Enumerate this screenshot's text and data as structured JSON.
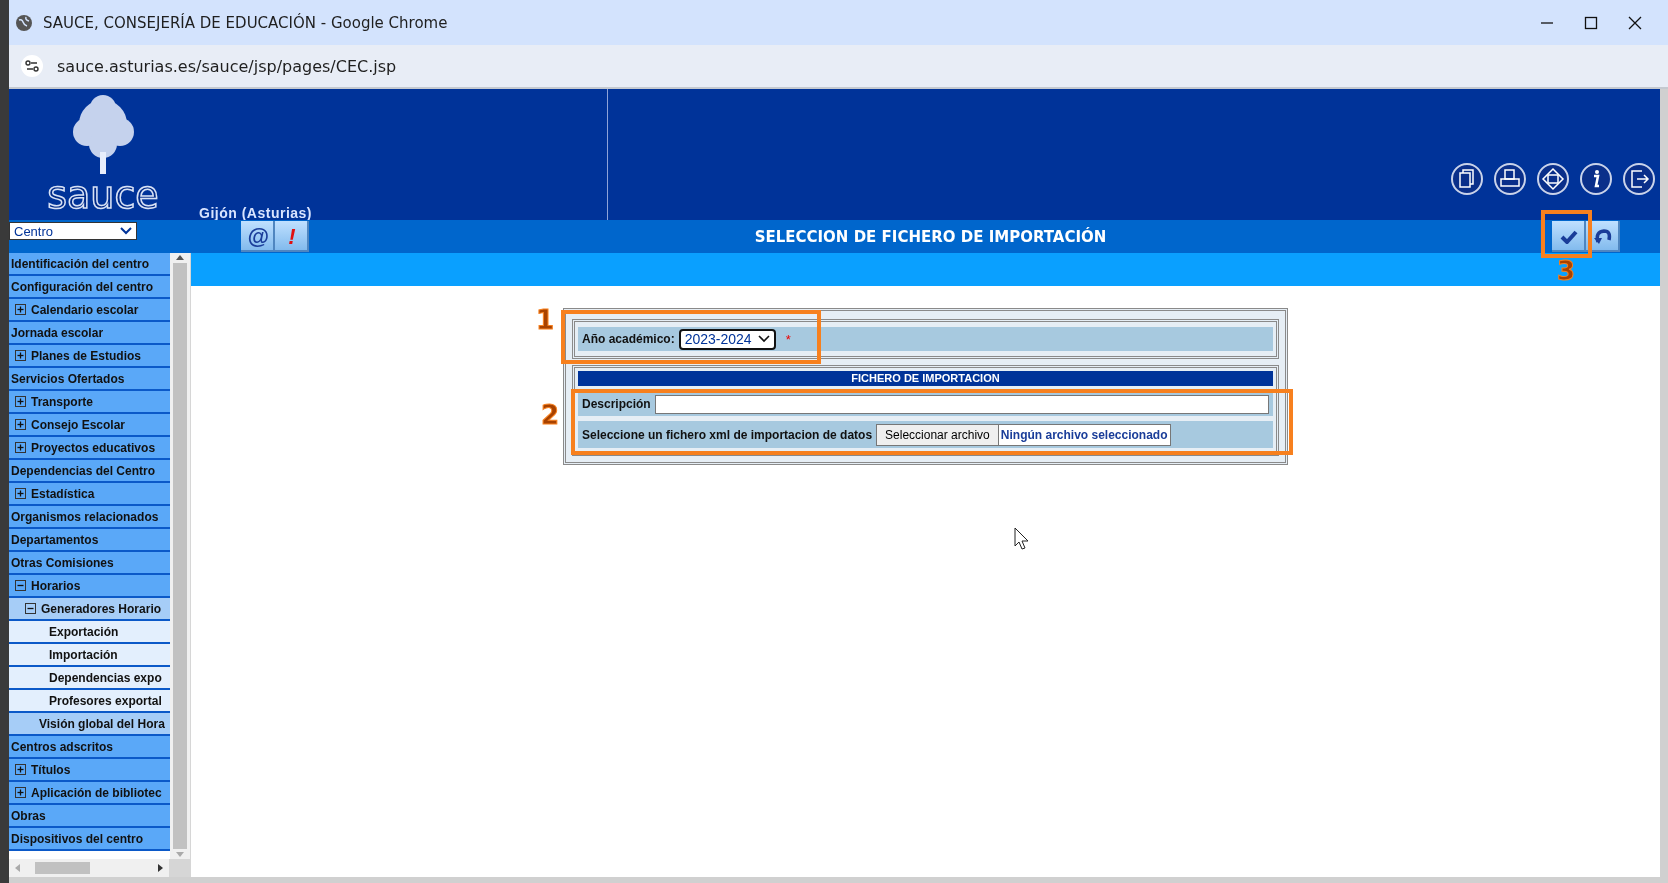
{
  "window": {
    "title": "SAUCE, CONSEJERÍA DE EDUCACIÓN - Google Chrome",
    "url": "sauce.asturias.es/sauce/jsp/pages/CEC.jsp"
  },
  "header": {
    "logo": "sauce",
    "location": "Gijón (Asturias)"
  },
  "sidebar": {
    "selector": "Centro",
    "items": [
      {
        "label": "Identificación del centro"
      },
      {
        "label": "Configuración del centro"
      },
      {
        "label": "Calendario escolar",
        "expanded": false
      },
      {
        "label": "Jornada escolar"
      },
      {
        "label": "Planes de Estudios",
        "expanded": false
      },
      {
        "label": "Servicios Ofertados"
      },
      {
        "label": "Transporte",
        "expanded": false
      },
      {
        "label": "Consejo Escolar",
        "expanded": false
      },
      {
        "label": "Proyectos educativos",
        "expanded": false
      },
      {
        "label": "Dependencias del Centro"
      },
      {
        "label": "Estadística",
        "expanded": false
      },
      {
        "label": "Organismos relacionados"
      },
      {
        "label": "Departamentos"
      },
      {
        "label": "Otras Comisiones"
      },
      {
        "label": "Horarios",
        "expanded": true,
        "children": [
          {
            "label": "Generadores Horario",
            "expanded": true,
            "children": [
              {
                "label": "Exportación"
              },
              {
                "label": "Importación"
              },
              {
                "label": "Dependencias expo"
              },
              {
                "label": "Profesores exportal"
              }
            ]
          },
          {
            "label": "Visión global del Hora"
          }
        ]
      },
      {
        "label": "Centros adscritos"
      },
      {
        "label": "Títulos",
        "expanded": false
      },
      {
        "label": "Aplicación de bibliotec",
        "expanded": false
      },
      {
        "label": "Obras"
      },
      {
        "label": "Dispositivos del centro"
      }
    ]
  },
  "toolbar": {
    "left_buttons": [
      "@",
      "!"
    ],
    "title": "SELECCION DE FICHERO DE IMPORTACIÓN"
  },
  "form": {
    "year": {
      "label": "Año académico:",
      "value": "2023-2024",
      "required_mark": "*"
    },
    "section_title": "FICHERO DE IMPORTACION",
    "description": {
      "label": "Descripción"
    },
    "file": {
      "label": "Seleccione un fichero xml de importacion de datos",
      "button": "Seleccionar archivo",
      "status": "Ningún archivo seleccionado"
    }
  },
  "annotations": [
    "1",
    "2",
    "3"
  ]
}
